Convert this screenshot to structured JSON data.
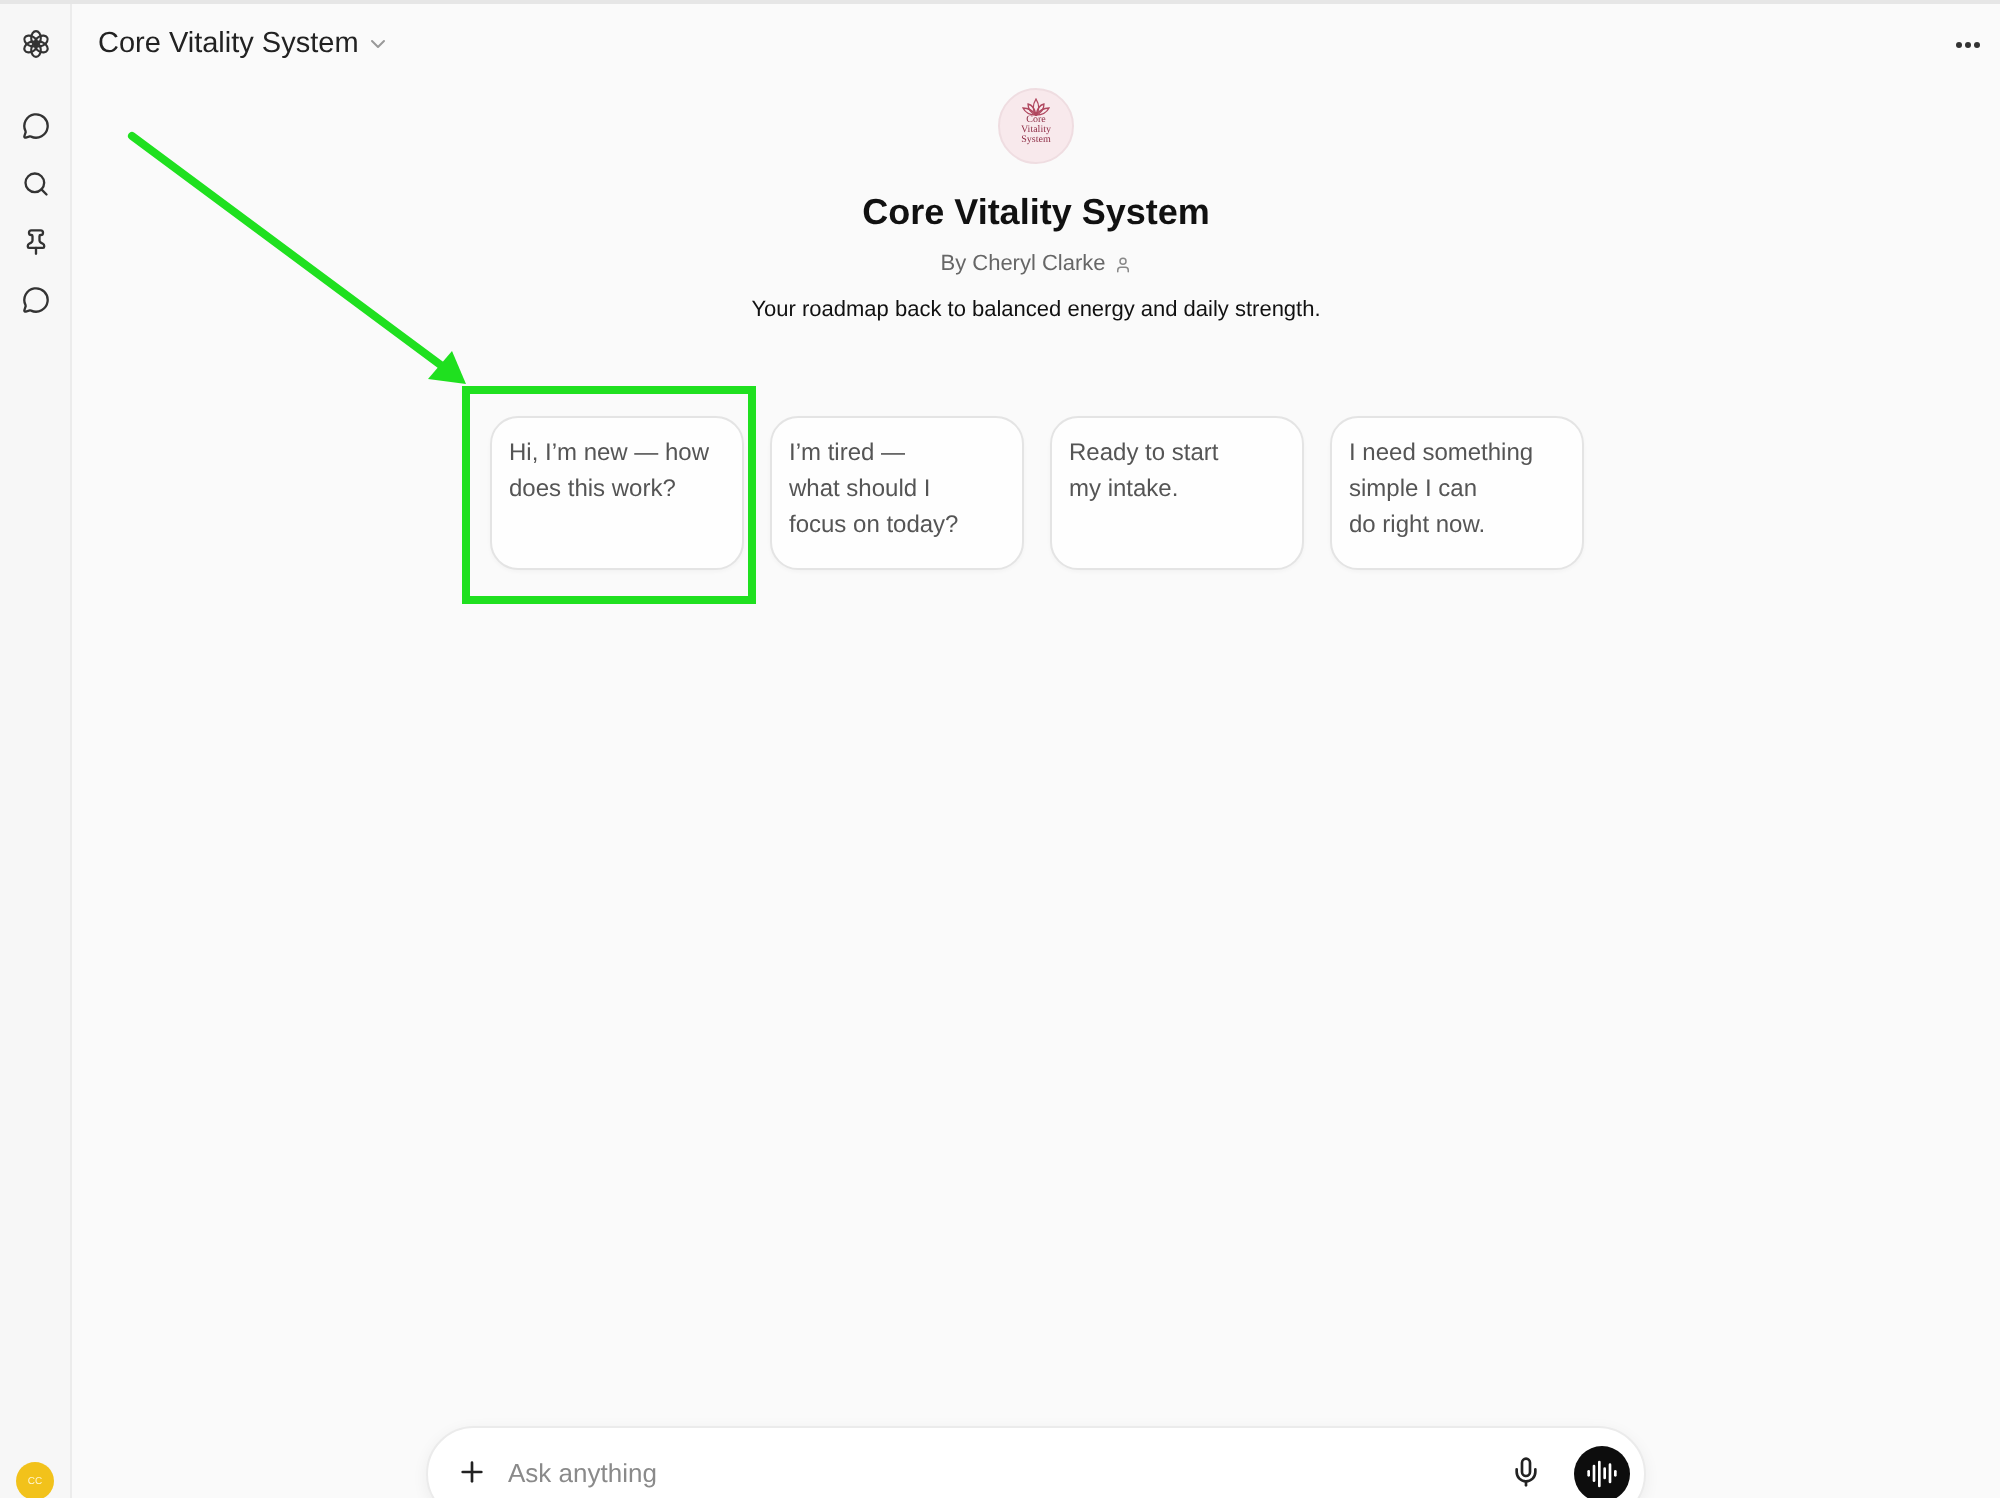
{
  "sidebar": {
    "avatar_initials": "CC"
  },
  "header": {
    "title": "Core Vitality System"
  },
  "gpt": {
    "logo_text": [
      "Core",
      "Vitality",
      "System"
    ],
    "name": "Core Vitality System",
    "author": "By Cheryl Clarke",
    "description": "Your roadmap back to balanced energy and daily strength."
  },
  "suggestions": [
    {
      "lines": [
        "Hi, I’m new — how",
        "does this work?"
      ],
      "highlighted": true
    },
    {
      "lines": [
        "I’m tired —",
        "what should I",
        "focus on today?"
      ],
      "highlighted": false
    },
    {
      "lines": [
        "Ready to start",
        "my intake."
      ],
      "highlighted": false
    },
    {
      "lines": [
        "I need something",
        "simple I can",
        "do right now."
      ],
      "highlighted": false
    }
  ],
  "composer": {
    "placeholder": "Ask anything"
  }
}
